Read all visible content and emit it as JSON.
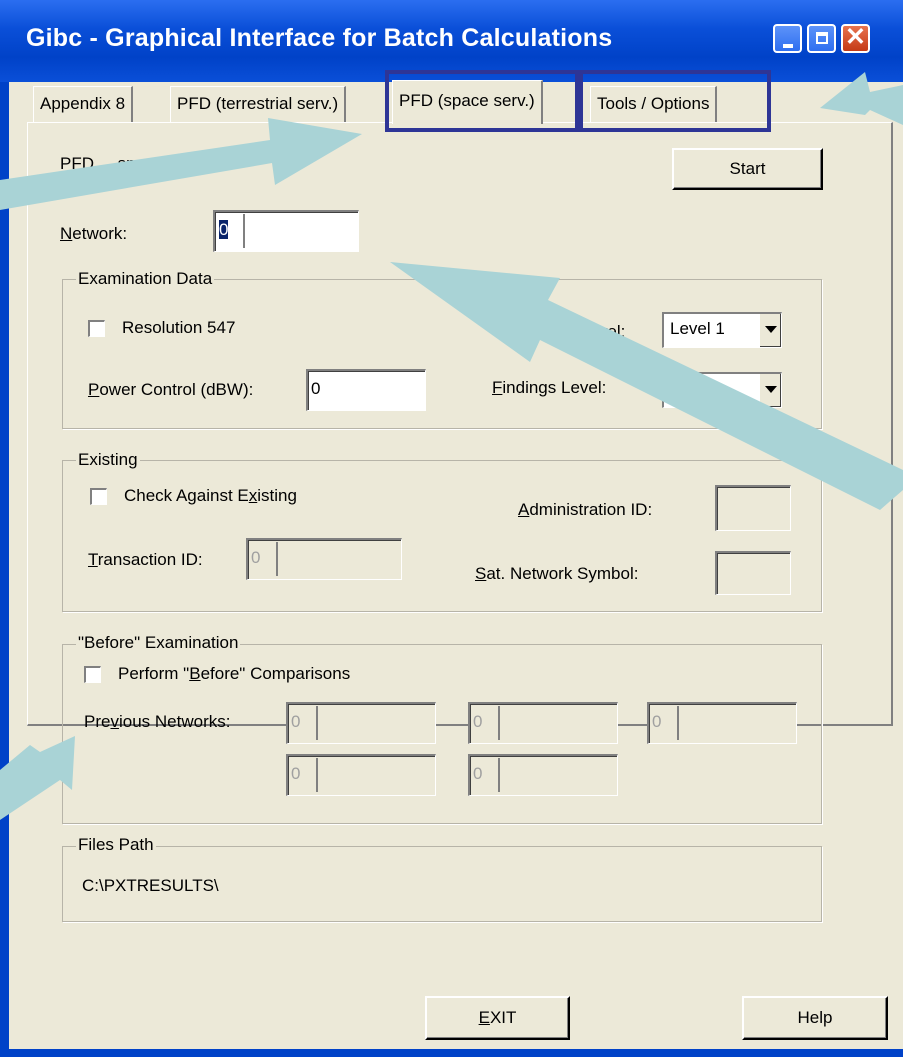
{
  "window": {
    "title": "Gibc - Graphical Interface for Batch Calculations"
  },
  "tabs": [
    {
      "label": "Appendix 8"
    },
    {
      "label": "PFD (terrestrial serv.)"
    },
    {
      "label": "PFD (space serv.)",
      "active": true
    },
    {
      "label": "Tools / Options"
    }
  ],
  "panel": {
    "description": "PFD ... space services.",
    "start_label": "Start",
    "network": {
      "label": "Network:",
      "mnemonic": "N",
      "label_rest": "etwork:",
      "prefix_value": "0",
      "value": ""
    }
  },
  "examination": {
    "title": "Examination Data",
    "resolution_label": "Resolution 547",
    "resolution_checked": false,
    "level_label": "Level:",
    "level_value": "Level 1",
    "power_label_pre": "",
    "power_mnemonic": "P",
    "power_label_rest": "ower Control (dBW):",
    "power_value": "0",
    "findings_mnemonic": "F",
    "findings_label_rest": "indings Level:",
    "findings_value": "..."
  },
  "existing": {
    "title": "Existing",
    "check_label_pre": "Check Against E",
    "check_mnemonic": "x",
    "check_label_rest": "isting",
    "check_checked": false,
    "admin_mnemonic": "A",
    "admin_label_rest": "dministration ID:",
    "transaction_mnemonic": "T",
    "transaction_label_rest": "ransaction ID:",
    "transaction_prefix": "0",
    "sat_mnemonic": "S",
    "sat_label_rest": "at. Network Symbol:"
  },
  "before": {
    "title": "\"Before\" Examination",
    "check_label_pre": "Perform \"",
    "check_mnemonic": "B",
    "check_label_rest": "efore\" Comparisons",
    "check_checked": false,
    "prev_label_pre": "Pre",
    "prev_mnemonic": "v",
    "prev_label_rest": "ious Networks:",
    "fields": [
      "0",
      "0",
      "0",
      "0",
      "0"
    ]
  },
  "files": {
    "title": "Files Path",
    "path": "C:\\PXTRESULTS\\"
  },
  "footer": {
    "exit_mnemonic": "E",
    "exit_rest": "XIT",
    "help_label": "Help"
  },
  "colors": {
    "titlebar": "#0a4fd8",
    "highlight_box": "#2e3596",
    "arrow": "#a9d3d6",
    "background": "#ECE9D8"
  }
}
